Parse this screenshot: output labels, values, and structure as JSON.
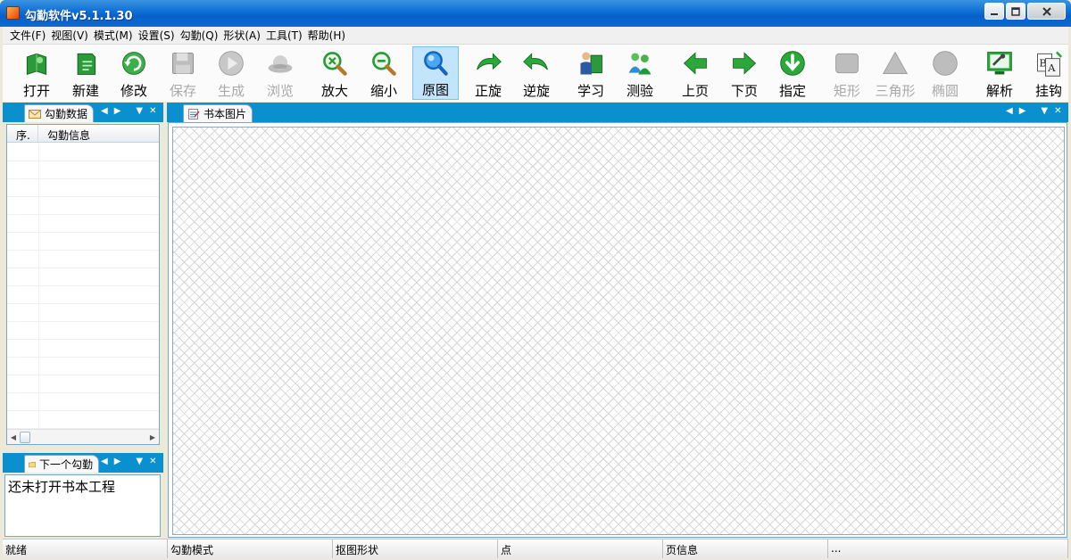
{
  "window": {
    "title": "勾勤软件v5.1.1.30",
    "minimize": "0",
    "maximize": "1",
    "close": "r"
  },
  "menu": [
    "文件(F)",
    "视图(V)",
    "模式(M)",
    "设置(S)",
    "勾勤(Q)",
    "形状(A)",
    "工具(T)",
    "帮助(H)"
  ],
  "toolbar": [
    {
      "label": "打开",
      "icon": "open-book-icon",
      "enabled": true,
      "active": false
    },
    {
      "label": "新建",
      "icon": "new-book-icon",
      "enabled": true,
      "active": false
    },
    {
      "label": "修改",
      "icon": "refresh-icon",
      "enabled": true,
      "active": false
    },
    {
      "label": "保存",
      "icon": "floppy-disk-icon",
      "enabled": false,
      "active": false
    },
    {
      "label": "生成",
      "icon": "play-icon",
      "enabled": false,
      "active": false
    },
    {
      "label": "浏览",
      "icon": "hat-icon",
      "enabled": false,
      "active": false
    },
    {
      "label": "放大",
      "icon": "zoom-in-icon",
      "enabled": true,
      "active": false
    },
    {
      "label": "缩小",
      "icon": "zoom-out-icon",
      "enabled": true,
      "active": false
    },
    {
      "label": "原图",
      "icon": "magnifier-icon",
      "enabled": true,
      "active": true
    },
    {
      "label": "正旋",
      "icon": "rotate-cw-icon",
      "enabled": true,
      "active": false
    },
    {
      "label": "逆旋",
      "icon": "rotate-ccw-icon",
      "enabled": true,
      "active": false
    },
    {
      "label": "学习",
      "icon": "person-book-icon",
      "enabled": true,
      "active": false
    },
    {
      "label": "测验",
      "icon": "people-icon",
      "enabled": true,
      "active": false
    },
    {
      "label": "上页",
      "icon": "arrow-left-icon",
      "enabled": true,
      "active": false
    },
    {
      "label": "下页",
      "icon": "arrow-right-icon",
      "enabled": true,
      "active": false
    },
    {
      "label": "指定",
      "icon": "arrow-down-circle-icon",
      "enabled": true,
      "active": false
    },
    {
      "label": "矩形",
      "icon": "rectangle-icon",
      "enabled": false,
      "active": false
    },
    {
      "label": "三角形",
      "icon": "triangle-icon",
      "enabled": false,
      "active": false
    },
    {
      "label": "椭圆",
      "icon": "ellipse-icon",
      "enabled": false,
      "active": false
    },
    {
      "label": "解析",
      "icon": "monitor-key-icon",
      "enabled": true,
      "active": false
    },
    {
      "label": "挂钩",
      "icon": "translate-icon",
      "enabled": true,
      "active": false
    }
  ],
  "left_panel": {
    "tab": "勾勤数据",
    "columns": [
      "序.",
      "勾勤信息"
    ],
    "nav": {
      "left": "◀",
      "right": "▶",
      "menu": "▼",
      "close": "✕"
    }
  },
  "bottom_left_panel": {
    "tab": "下一个勾勤",
    "message": "还未打开书本工程"
  },
  "main_panel": {
    "tab": "书本图片"
  },
  "statusbar": [
    "就绪",
    "勾勤模式",
    "抠图形状",
    "点",
    "页信息",
    "..."
  ]
}
